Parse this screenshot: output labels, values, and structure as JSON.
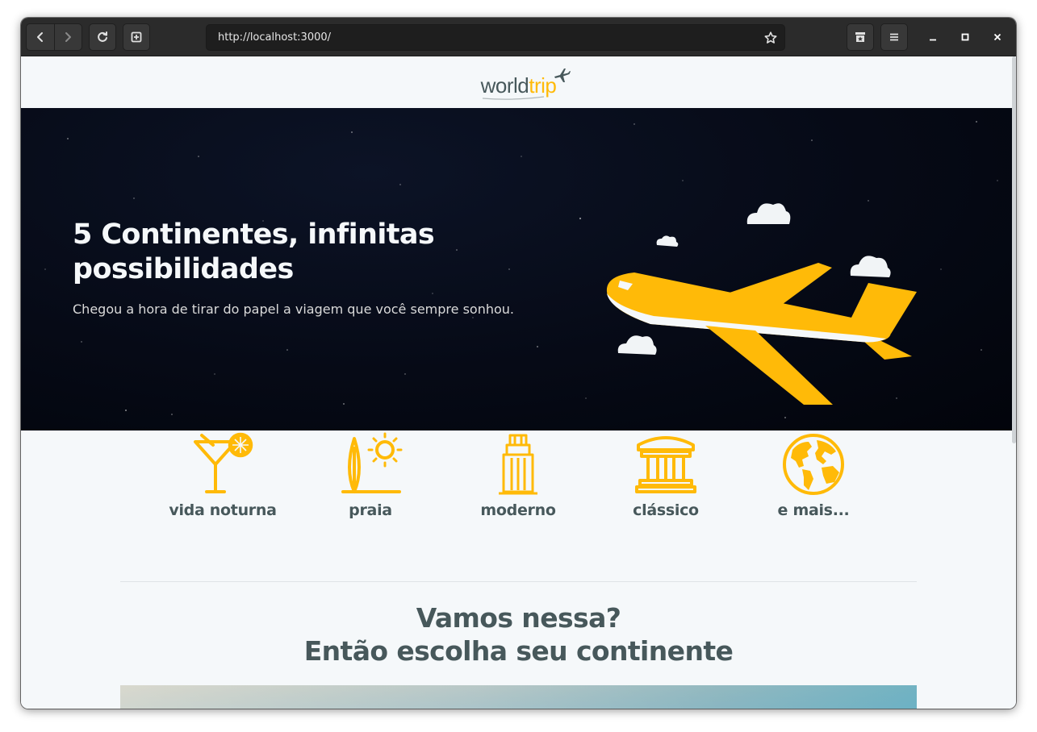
{
  "browser": {
    "url": "http://localhost:3000/"
  },
  "logo": {
    "part1": "world",
    "part2": "trip"
  },
  "banner": {
    "title": "5 Continentes, infinitas possibilidades",
    "subtitle": "Chegou a hora de tirar do papel a viagem que você sempre sonhou."
  },
  "travel_types": [
    {
      "label": "vida noturna",
      "icon": "cocktail-icon"
    },
    {
      "label": "praia",
      "icon": "surf-sun-icon"
    },
    {
      "label": "moderno",
      "icon": "building-icon"
    },
    {
      "label": "clássico",
      "icon": "museum-icon"
    },
    {
      "label": "e mais...",
      "icon": "earth-icon"
    }
  ],
  "cta": {
    "line1": "Vamos nessa?",
    "line2": "Então escolha seu continente"
  },
  "colors": {
    "accent": "#ffba08",
    "text_dark": "#47585b",
    "background": "#f5f8fa",
    "banner_bg": "#060a16"
  }
}
